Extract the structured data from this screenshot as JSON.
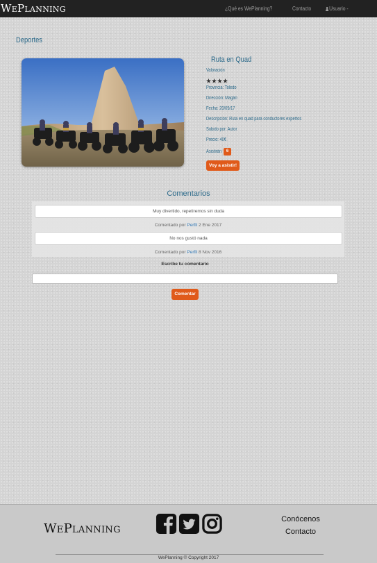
{
  "navbar": {
    "brand": "WePlanning",
    "links": [
      "¿Qué es WePlanning?",
      "Contacto"
    ],
    "user_menu": "Usuario -"
  },
  "section_title": "Deportes",
  "activity": {
    "title": "Ruta en Quad",
    "rating_label": "Valoración",
    "rating": 4,
    "rating_max": 4,
    "provincia": "Provincia: Toledo",
    "direccion": "Dirección: Magán",
    "fecha": "Fecha: 20/09/17",
    "descripcion": "Descripción: Ruta en quad para conductores expertos",
    "subido": "Subido por: Autor",
    "precio": "Precio: 40€",
    "asistiran_label": "Asistirán",
    "asistiran_count": "6",
    "go_button": "Voy a asistir!"
  },
  "comments": {
    "title": "Comentarios",
    "items": [
      {
        "text": "Muy divertido, repetiremos sin duda",
        "prefix": "Comentado por",
        "link": "Perfil",
        "date": "2 Ene 2017"
      },
      {
        "text": "No nos gustó nada",
        "prefix": "Comentado por",
        "link": "Perfil",
        "date": "8 Nov 2016"
      }
    ],
    "write_label": "Escribe tu comentario",
    "textarea_value": "",
    "submit_label": "Comentar"
  },
  "footer": {
    "brand": "WePlanning",
    "social_icons": [
      "facebook-icon",
      "twitter-icon",
      "instagram-icon"
    ],
    "links": [
      "Conócenos",
      "Contacto"
    ],
    "copyright": "WePlanning © Copyright 2017"
  },
  "colors": {
    "accent_orange": "#e05a1a",
    "heading_blue": "#2c6a8a",
    "navbar_bg": "#222222",
    "footer_bg": "#c9c9c9"
  }
}
